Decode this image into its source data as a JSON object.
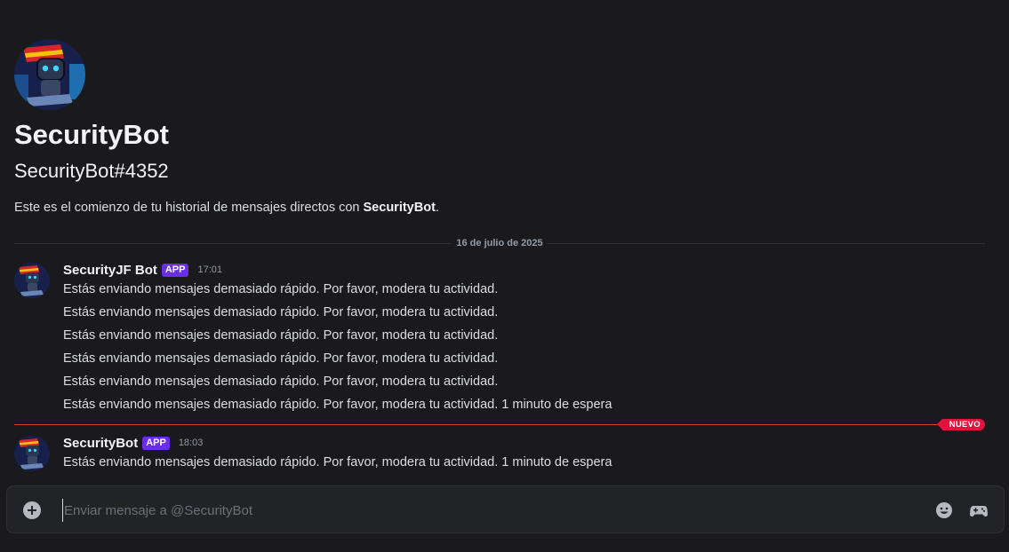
{
  "intro": {
    "name": "SecurityBot",
    "tag": "SecurityBot#4352",
    "desc_prefix": "Este es el comienzo de tu historial de mensajes directos con ",
    "desc_name": "SecurityBot",
    "desc_suffix": "."
  },
  "date_divider": "16 de julio de 2025",
  "messages": [
    {
      "author": "SecurityJF Bot",
      "badge": "APP",
      "time": "17:01",
      "lines": [
        "Estás enviando mensajes demasiado rápido. Por favor, modera tu actividad.",
        "Estás enviando mensajes demasiado rápido. Por favor, modera tu actividad.",
        "Estás enviando mensajes demasiado rápido. Por favor, modera tu actividad.",
        "Estás enviando mensajes demasiado rápido. Por favor, modera tu actividad.",
        "Estás enviando mensajes demasiado rápido. Por favor, modera tu actividad.",
        "Estás enviando mensajes demasiado rápido. Por favor, modera tu actividad. 1 minuto de espera"
      ]
    },
    {
      "author": "SecurityBot",
      "badge": "APP",
      "time": "18:03",
      "lines": [
        "Estás enviando mensajes demasiado rápido. Por favor, modera tu actividad. 1 minuto de espera"
      ]
    }
  ],
  "new_divider": "NUEVO",
  "composer": {
    "placeholder": "Enviar mensaje a @SecurityBot",
    "value": ""
  },
  "icons": {
    "attach": "plus-circle-icon",
    "emoji": "emoji-icon",
    "apps": "gamepad-icon"
  },
  "colors": {
    "background": "#1a1a1e",
    "app_badge": "#6a2ee8",
    "new_divider": "#e0153e"
  }
}
